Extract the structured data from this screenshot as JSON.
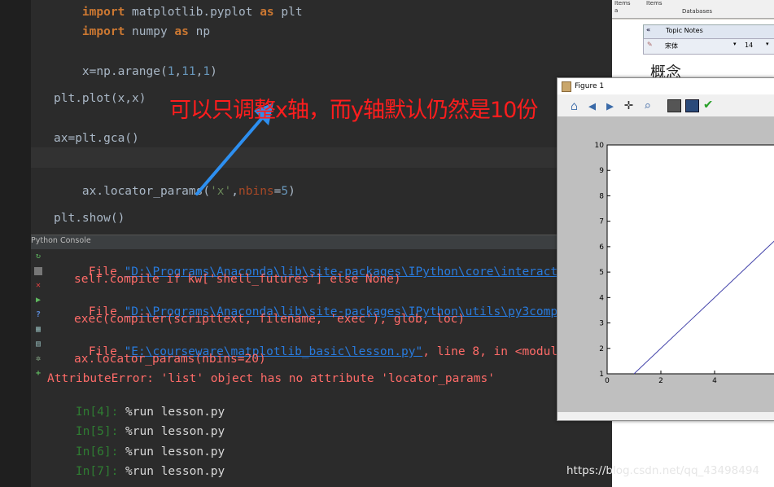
{
  "editor": {
    "line_partial_top": [
      "import",
      " matplotlib.pyplot ",
      "as",
      " plt"
    ],
    "line_import_numpy": [
      "import",
      " numpy ",
      "as",
      " np"
    ],
    "line_arange": [
      "x=np.arange(",
      "1",
      ",",
      "11",
      ",",
      "1",
      ")"
    ],
    "line_plot": "plt.plot(x,x)",
    "line_gca": "ax=plt.gca()",
    "line_locator": [
      "ax.locator_params(",
      "'x'",
      ",",
      "nbins",
      "=",
      "5",
      ")"
    ],
    "line_show": "plt.show()"
  },
  "console": {
    "title": "Python Console",
    "lines": {
      "file1_pre": "File ",
      "file1_path": "\"D:\\Programs\\Anaconda\\lib\\site-packages\\IPython\\core\\interactiveshell.",
      "compile": "self.compile if kw['shell_futures'] else None)",
      "file2_pre": "File ",
      "file2_path": "\"D:\\Programs\\Anaconda\\lib\\site-packages\\IPython\\utils\\py3compat.py\"",
      "file2_post": ", l",
      "exec": "exec(compiler(scripttext, filename, 'exec'), glob, loc)",
      "file3_pre": "File ",
      "file3_path": "\"E:\\courseware\\matplotlib_basic\\lesson.py\"",
      "file3_post": ", line 8, in <module>",
      "locator_err": "ax.locator_params(nbins=20)",
      "attr_err": "AttributeError: 'list' object has no attribute 'locator_params'"
    },
    "prompts": [
      {
        "prompt": "In[4]:",
        "cmd": " %run lesson.py"
      },
      {
        "prompt": "In[5]:",
        "cmd": " %run lesson.py"
      },
      {
        "prompt": "In[6]:",
        "cmd": " %run lesson.py"
      },
      {
        "prompt": "In[7]:",
        "cmd": " %run lesson.py"
      }
    ]
  },
  "right_app": {
    "ribbon_items_1": "Items",
    "ribbon_items_2": "Items",
    "ribbon_a": "a",
    "ribbon_databases": "Databases",
    "topic_notes": "Topic Notes",
    "font_name": "宋体",
    "font_size": "14",
    "concept_text": "概念"
  },
  "figure": {
    "title": "Figure 1"
  },
  "chart_data": {
    "type": "line",
    "x": [
      1,
      2,
      3,
      4,
      5,
      6,
      7,
      8,
      9,
      10
    ],
    "series": [
      {
        "values": [
          1,
          2,
          3,
          4,
          5,
          6,
          7,
          8,
          9,
          10
        ]
      }
    ],
    "xlim": [
      0,
      10
    ],
    "ylim": [
      1,
      10
    ],
    "xticks": [
      "0",
      "2",
      "4"
    ],
    "yticks": [
      "1",
      "2",
      "3",
      "4",
      "5",
      "6",
      "7",
      "8",
      "9",
      "10"
    ],
    "line_color": "#4444aa"
  },
  "annotation": "可以只调整x轴，而y轴默认仍然是10份",
  "watermark": "https://blog.csdn.net/qq_43498494"
}
